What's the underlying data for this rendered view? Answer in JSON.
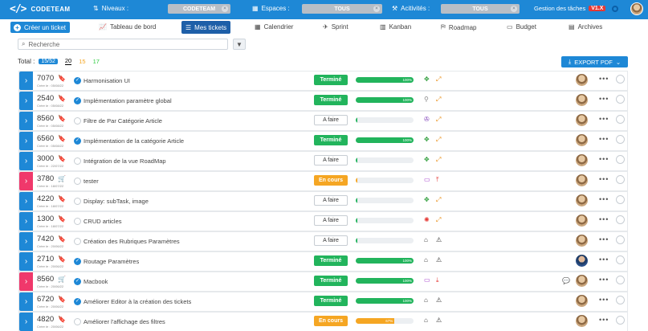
{
  "topbar": {
    "logo_mark": "</>",
    "logo_text": "CODETEAM",
    "niveaux_label": "Niveaux :",
    "niveaux_value": "CODETEAM",
    "espaces_label": "Espaces :",
    "espaces_value": "TOUS",
    "activites_label": "Acitivités :",
    "activites_value": "TOUS",
    "gestion_label": "Gestion des tâches",
    "version_badge": "V1.X"
  },
  "nav": {
    "create_label": "Créer un ticket",
    "items": [
      {
        "label": "Tableau de bord",
        "icon": "chart-icon"
      },
      {
        "label": "Mes tickets",
        "icon": "list-icon"
      },
      {
        "label": "Calendrier",
        "icon": "calendar-icon"
      },
      {
        "label": "Sprint",
        "icon": "plane-icon"
      },
      {
        "label": "Kanban",
        "icon": "kanban-icon"
      },
      {
        "label": "Roadmap",
        "icon": "map-icon"
      },
      {
        "label": "Budget",
        "icon": "budget-icon"
      },
      {
        "label": "Archives",
        "icon": "archive-icon"
      }
    ]
  },
  "search": {
    "placeholder": "Recherche"
  },
  "total": {
    "label": "Total :",
    "badge": "15/52",
    "count_black": "20",
    "count_orange": "15",
    "count_green": "17"
  },
  "export_label": "EXPORT PDF",
  "tickets": [
    {
      "num": "7070",
      "date": "Créer le : 05/08/22",
      "type": "bookmark",
      "done": true,
      "title": "Harmonisation UI",
      "status": "Terminé",
      "progress": 100,
      "progress_label": "100%"
    },
    {
      "num": "2540",
      "date": "Créer le : 05/08/22",
      "type": "bookmark",
      "done": true,
      "title": "Implémentation paramètre global",
      "status": "Terminé",
      "progress": 100,
      "progress_label": "100%"
    },
    {
      "num": "8560",
      "date": "Créer le : 05/08/22",
      "type": "bookmark",
      "done": false,
      "title": "Filtre de Par Catégorie Article",
      "status": "A faire",
      "progress": 0,
      "progress_label": ""
    },
    {
      "num": "6560",
      "date": "Créer le : 05/08/22",
      "type": "bookmark",
      "done": true,
      "title": "Implémentation de la catégorie Article",
      "status": "Terminé",
      "progress": 100,
      "progress_label": "100%"
    },
    {
      "num": "3000",
      "date": "Créer le : 22/07/22",
      "type": "bookmark",
      "done": false,
      "title": "Intégration de la vue RoadMap",
      "status": "A faire",
      "progress": 0,
      "progress_label": ""
    },
    {
      "num": "3780",
      "date": "Créer le : 18/07/22",
      "type": "cart",
      "done": false,
      "title": "tester",
      "status": "En cours",
      "progress": 0,
      "progress_label": ""
    },
    {
      "num": "4220",
      "date": "Créer le : 18/07/22",
      "type": "bookmark",
      "done": false,
      "title": "Display: subTask, image",
      "status": "A faire",
      "progress": 0,
      "progress_label": ""
    },
    {
      "num": "1300",
      "date": "Créer le : 18/07/22",
      "type": "bookmark",
      "done": false,
      "title": "CRUD articles",
      "status": "A faire",
      "progress": 0,
      "progress_label": ""
    },
    {
      "num": "7420",
      "date": "Créer le : 20/06/22",
      "type": "bookmark",
      "done": false,
      "title": "Création des Rubriques Paramètres",
      "status": "A faire",
      "progress": 0,
      "progress_label": ""
    },
    {
      "num": "2710",
      "date": "Créer le : 20/06/22",
      "type": "bookmark",
      "done": true,
      "title": "Routage Paramètres",
      "status": "Terminé",
      "progress": 100,
      "progress_label": "100%"
    },
    {
      "num": "8560",
      "date": "Créer le : 20/06/22",
      "type": "cart",
      "done": true,
      "title": "Macbook",
      "status": "Terminé",
      "progress": 100,
      "progress_label": "100%"
    },
    {
      "num": "6720",
      "date": "Créer le : 20/06/22",
      "type": "bookmark",
      "done": true,
      "title": "Améliorer Editor à la création des tickets",
      "status": "Terminé",
      "progress": 100,
      "progress_label": "100%"
    },
    {
      "num": "4820",
      "date": "Créer le : 20/06/22",
      "type": "bookmark",
      "done": false,
      "title": "Améliorer l'affichage des filtres",
      "status": "En cours",
      "progress": 67,
      "progress_label": "67%"
    }
  ]
}
